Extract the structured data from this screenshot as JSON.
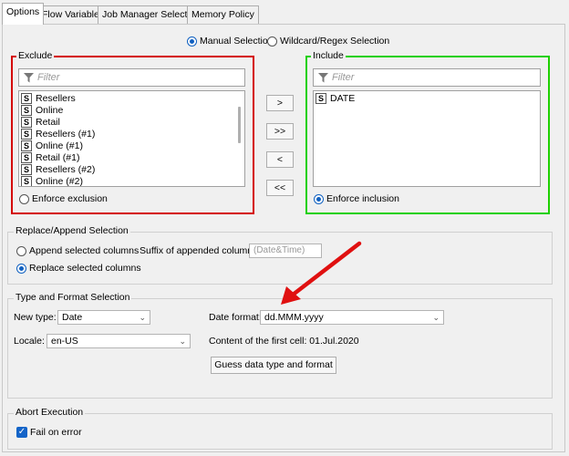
{
  "tabs": [
    "Options",
    "Flow Variables",
    "Job Manager Selection",
    "Memory Policy"
  ],
  "selection_mode": {
    "manual_label": "Manual Selection",
    "wildcard_label": "Wildcard/Regex Selection",
    "selected": "manual"
  },
  "exclude": {
    "title": "Exclude",
    "filter_placeholder": "Filter",
    "items": [
      "Resellers",
      "Online",
      "Retail",
      "Resellers (#1)",
      "Online (#1)",
      "Retail (#1)",
      "Resellers (#2)",
      "Online (#2)"
    ],
    "type_badge": "S",
    "enforce_label": "Enforce exclusion",
    "enforce_selected": false
  },
  "include": {
    "title": "Include",
    "filter_placeholder": "Filter",
    "items": [
      "DATE"
    ],
    "type_badge": "S",
    "enforce_label": "Enforce inclusion",
    "enforce_selected": true
  },
  "move_buttons": [
    ">",
    ">>",
    "<",
    "<<"
  ],
  "replace_append": {
    "title": "Replace/Append Selection",
    "append_label": "Append selected columns",
    "replace_label": "Replace selected columns",
    "selected": "replace",
    "suffix_label": "Suffix of appended columns:",
    "suffix_placeholder": "(Date&Time)"
  },
  "type_format": {
    "title": "Type and Format Selection",
    "new_type_label": "New type:",
    "new_type_value": "Date",
    "date_format_label": "Date format:",
    "date_format_value": "dd.MMM.yyyy",
    "locale_label": "Locale:",
    "locale_value": "en-US",
    "first_cell_text": "Content of the first cell: 01.Jul.2020",
    "guess_button": "Guess data type and format"
  },
  "abort": {
    "title": "Abort Execution",
    "fail_label": "Fail on error",
    "fail_checked": true
  },
  "colors": {
    "exclude_border": "#d40000",
    "include_border": "#1ed000",
    "arrow": "#e01010",
    "accent": "#1060c0"
  }
}
